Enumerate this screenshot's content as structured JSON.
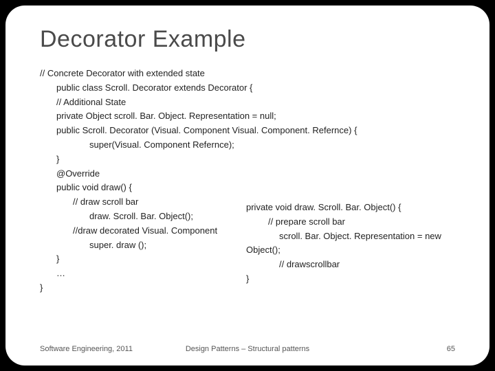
{
  "title": "Decorator Example",
  "code": {
    "l0": "// Concrete Decorator with extended state",
    "l1": "public class Scroll. Decorator extends Decorator {",
    "l2": "// Additional State",
    "l3": "private Object  scroll. Bar. Object. Representation = null;",
    "l4": "public Scroll. Decorator (Visual. Component  Visual. Component. Refernce) {",
    "l5": "super(Visual. Component Refernce);",
    "l6": "}",
    "l7": "@Override",
    "l8": "public void draw() {",
    "l9": "// draw scroll bar",
    "l10": "draw. Scroll. Bar. Object();",
    "l11": "//draw decorated Visual. Component",
    "l12": "super. draw ();",
    "l13": "}",
    "l14": "…",
    "l15": "}"
  },
  "overlay": {
    "o0": "private void draw. Scroll. Bar. Object() {",
    "o1": "// prepare scroll bar",
    "o2": "scroll. Bar. Object. Representation = new",
    "o3": "Object();",
    "o4": "// drawscrollbar",
    "o5": "}"
  },
  "footer": {
    "left": "Software Engineering, 2011",
    "center": "Design Patterns – Structural patterns",
    "page": "65"
  }
}
